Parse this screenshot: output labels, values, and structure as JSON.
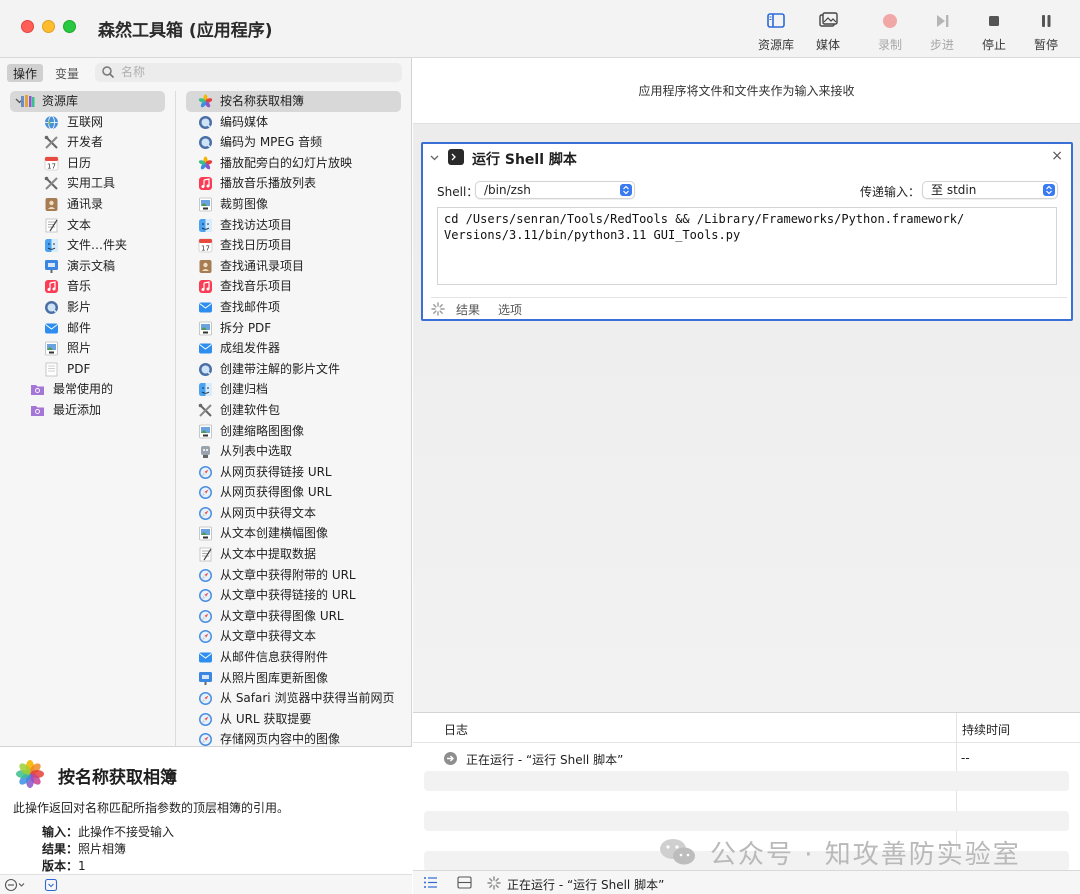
{
  "window": {
    "title": "森然工具箱 (应用程序)"
  },
  "toolbar": {
    "library": "资源库",
    "media": "媒体",
    "record": "录制",
    "step": "步进",
    "stop": "停止",
    "pause": "暂停"
  },
  "sidebar": {
    "seg_actions": "操作",
    "seg_variables": "变量",
    "search_placeholder": "名称",
    "library_items": [
      {
        "label": "资源库",
        "icon": "library-icon"
      },
      {
        "label": "互联网",
        "icon": "globe-icon"
      },
      {
        "label": "开发者",
        "icon": "tools-icon"
      },
      {
        "label": "日历",
        "icon": "calendar-icon"
      },
      {
        "label": "实用工具",
        "icon": "tools-icon"
      },
      {
        "label": "通讯录",
        "icon": "contacts-icon"
      },
      {
        "label": "文本",
        "icon": "text-icon"
      },
      {
        "label": "文件…件夹",
        "icon": "finder-icon"
      },
      {
        "label": "演示文稿",
        "icon": "keynote-icon"
      },
      {
        "label": "音乐",
        "icon": "music-icon"
      },
      {
        "label": "影片",
        "icon": "quicktime-icon"
      },
      {
        "label": "邮件",
        "icon": "mail-icon"
      },
      {
        "label": "照片",
        "icon": "preview-icon"
      },
      {
        "label": "PDF",
        "icon": "pdf-icon"
      },
      {
        "label": "最常使用的",
        "icon": "smart-folder-icon"
      },
      {
        "label": "最近添加",
        "icon": "smart-folder-icon"
      }
    ],
    "actions": [
      {
        "label": "按名称获取相簿",
        "icon": "photos-icon"
      },
      {
        "label": "编码媒体",
        "icon": "quicktime-icon"
      },
      {
        "label": "编码为 MPEG 音频",
        "icon": "quicktime-icon"
      },
      {
        "label": "播放配旁白的幻灯片放映",
        "icon": "photos-icon"
      },
      {
        "label": "播放音乐播放列表",
        "icon": "music-icon"
      },
      {
        "label": "裁剪图像",
        "icon": "preview-icon"
      },
      {
        "label": "查找访达项目",
        "icon": "finder-icon"
      },
      {
        "label": "查找日历项目",
        "icon": "calendar-icon"
      },
      {
        "label": "查找通讯录项目",
        "icon": "contacts-icon"
      },
      {
        "label": "查找音乐项目",
        "icon": "music-icon"
      },
      {
        "label": "查找邮件项",
        "icon": "mail-icon"
      },
      {
        "label": "拆分 PDF",
        "icon": "preview-icon"
      },
      {
        "label": "成组发件器",
        "icon": "mail-icon"
      },
      {
        "label": "创建带注解的影片文件",
        "icon": "quicktime-icon"
      },
      {
        "label": "创建归档",
        "icon": "finder-icon"
      },
      {
        "label": "创建软件包",
        "icon": "tools-icon"
      },
      {
        "label": "创建缩略图图像",
        "icon": "preview-icon"
      },
      {
        "label": "从列表中选取",
        "icon": "automator-icon"
      },
      {
        "label": "从网页获得链接 URL",
        "icon": "safari-icon"
      },
      {
        "label": "从网页获得图像 URL",
        "icon": "safari-icon"
      },
      {
        "label": "从网页中获得文本",
        "icon": "safari-icon"
      },
      {
        "label": "从文本创建横幅图像",
        "icon": "preview-icon"
      },
      {
        "label": "从文本中提取数据",
        "icon": "text-icon"
      },
      {
        "label": "从文章中获得附带的 URL",
        "icon": "safari-icon"
      },
      {
        "label": "从文章中获得链接的 URL",
        "icon": "safari-icon"
      },
      {
        "label": "从文章中获得图像 URL",
        "icon": "safari-icon"
      },
      {
        "label": "从文章中获得文本",
        "icon": "safari-icon"
      },
      {
        "label": "从邮件信息获得附件",
        "icon": "mail-icon"
      },
      {
        "label": "从照片图库更新图像",
        "icon": "keynote-icon"
      },
      {
        "label": "从 Safari 浏览器中获得当前网页",
        "icon": "safari-icon"
      },
      {
        "label": "从 URL 获取提要",
        "icon": "safari-icon"
      },
      {
        "label": "存储网页内容中的图像",
        "icon": "safari-icon"
      }
    ]
  },
  "description": {
    "title": "按名称获取相簿",
    "text": "此操作返回对名称匹配所指参数的顶层相簿的引用。",
    "input_label": "输入：",
    "input_value": "此操作不接受输入",
    "result_label": "结果：",
    "result_value": "照片相簿",
    "version_label": "版本：",
    "version_value": "1"
  },
  "workflow": {
    "hint": "应用程序将文件和文件夹作为输入来接收",
    "card": {
      "title": "运行 Shell 脚本",
      "shell_label": "Shell：",
      "shell_value": "/bin/zsh",
      "pass_input_label": "传递输入：",
      "pass_input_value": "至 stdin",
      "script_line1": "cd /Users/senran/Tools/RedTools && /Library/Frameworks/Python.framework/",
      "script_line2": "Versions/3.11/bin/python3.11 GUI_Tools.py",
      "tab_results": "结果",
      "tab_options": "选项",
      "close": "×"
    }
  },
  "log": {
    "col_log": "日志",
    "col_duration": "持续时间",
    "entry_text": "正在运行 - “运行 Shell 脚本”",
    "entry_duration": "--"
  },
  "status": {
    "text": "正在运行 - “运行 Shell 脚本”"
  },
  "watermark": {
    "text": "公众号 · 知攻善防实验室"
  },
  "colors": {
    "accent": "#3a6fd8",
    "selection": "#d8d8d8",
    "record_disabled": "#f2a7a7"
  }
}
